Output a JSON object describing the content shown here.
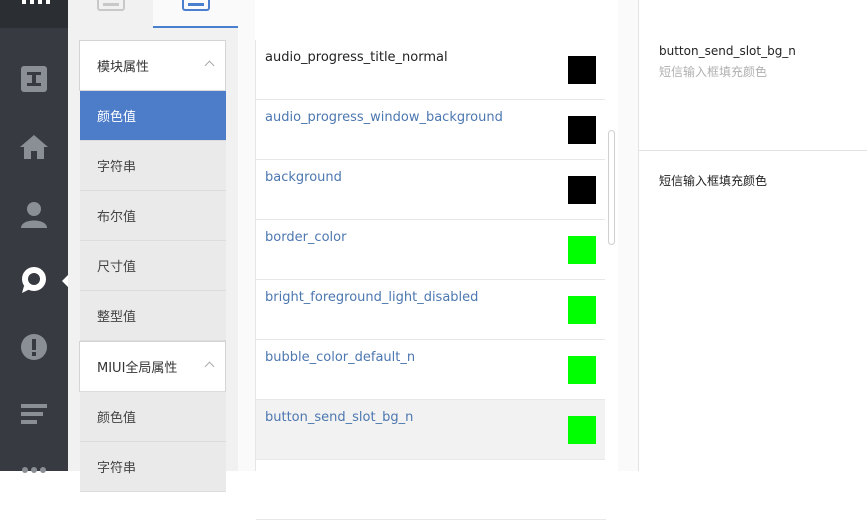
{
  "rail": {
    "icons": [
      {
        "name": "text-icon"
      },
      {
        "name": "home-icon"
      },
      {
        "name": "user-icon"
      },
      {
        "name": "chat-bubble-icon"
      },
      {
        "name": "alert-icon"
      },
      {
        "name": "lines-icon"
      }
    ],
    "active_index": 3
  },
  "tabs": [
    {
      "name": "tab-preview",
      "active": false
    },
    {
      "name": "tab-edit",
      "active": true
    }
  ],
  "categories": {
    "group1_title": "模块属性",
    "group1_items": [
      "颜色值",
      "字符串",
      "布尔值",
      "尺寸值",
      "整型值"
    ],
    "group2_title": "MIUI全局属性",
    "group2_items": [
      "颜色值",
      "字符串"
    ],
    "active": "颜色值"
  },
  "list": {
    "rows": [
      {
        "name": "audio_progress_title_normal",
        "color": "#000000"
      },
      {
        "name": "audio_progress_window_background",
        "color": "#000000"
      },
      {
        "name": "background",
        "color": "#000000"
      },
      {
        "name": "border_color",
        "color": "#00ff00"
      },
      {
        "name": "bright_foreground_light_disabled",
        "color": "#00ff00"
      },
      {
        "name": "bubble_color_default_n",
        "color": "#00ff00"
      },
      {
        "name": "button_send_slot_bg_n",
        "color": "#00ff00"
      }
    ],
    "selected": "button_send_slot_bg_n"
  },
  "detail": {
    "key": "button_send_slot_bg_n",
    "description": "短信输入框填充颜色",
    "value": "短信输入框填充颜色"
  },
  "colors": {
    "rail_bg": "#373b41",
    "accent": "#4d7cc9",
    "link": "#4c77b0"
  }
}
